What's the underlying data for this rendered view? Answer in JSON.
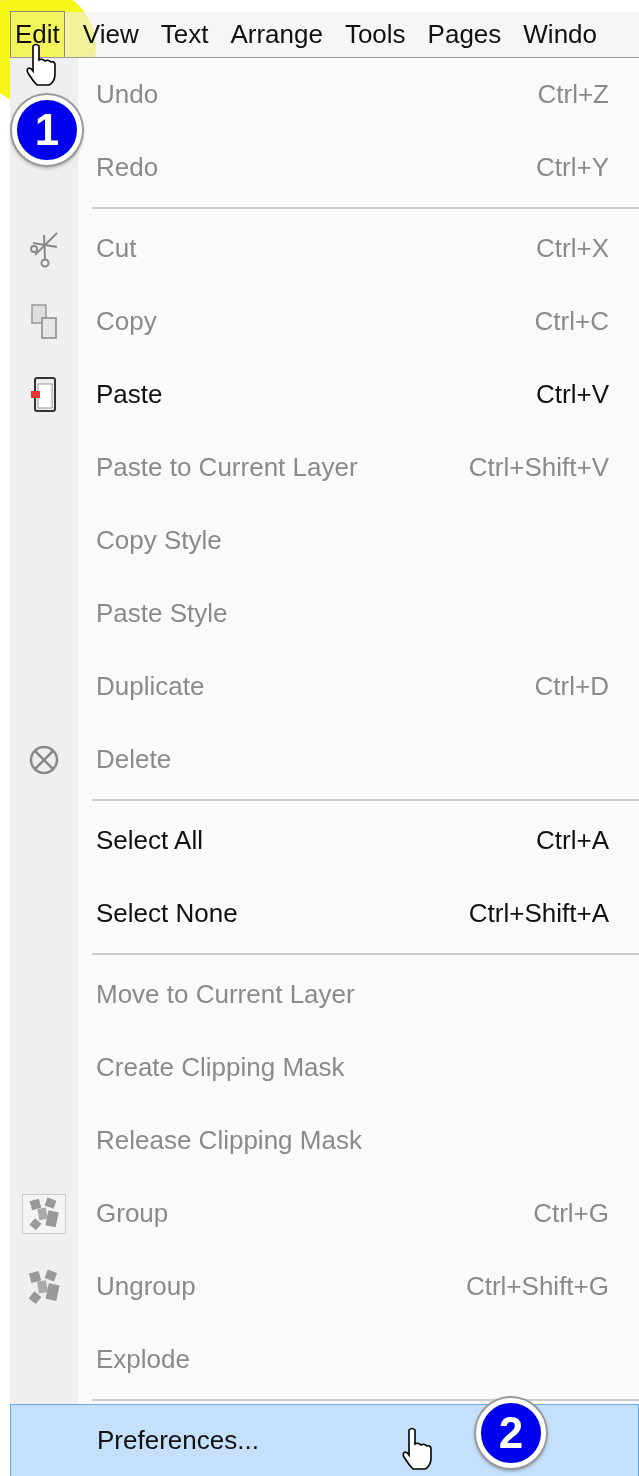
{
  "menu_bar": [
    {
      "label": "Edit",
      "selected": true
    },
    {
      "label": "View",
      "selected": false
    },
    {
      "label": "Text",
      "selected": false
    },
    {
      "label": "Arrange",
      "selected": false
    },
    {
      "label": "Tools",
      "selected": false
    },
    {
      "label": "Pages",
      "selected": false
    },
    {
      "label": "Windo",
      "selected": false
    }
  ],
  "menu": [
    {
      "kind": "item",
      "label": "Undo",
      "shortcut": "Ctrl+Z",
      "disabled": true,
      "selected": false
    },
    {
      "kind": "item",
      "label": "Redo",
      "shortcut": "Ctrl+Y",
      "disabled": true,
      "selected": false
    },
    {
      "kind": "separator"
    },
    {
      "kind": "scissors",
      "label": "Cut",
      "shortcut": "Ctrl+X",
      "disabled": true,
      "selected": false
    },
    {
      "kind": "copy",
      "label": "Copy",
      "shortcut": "Ctrl+C",
      "disabled": true,
      "selected": false
    },
    {
      "kind": "paste",
      "label": "Paste",
      "shortcut": "Ctrl+V",
      "disabled": false,
      "selected": false
    },
    {
      "kind": "item",
      "label": "Paste to Current Layer",
      "shortcut": "Ctrl+Shift+V",
      "disabled": true,
      "selected": false
    },
    {
      "kind": "item",
      "label": "Copy Style",
      "disabled": true,
      "selected": false
    },
    {
      "kind": "item",
      "label": "Paste Style",
      "disabled": true,
      "selected": false
    },
    {
      "kind": "item",
      "label": "Duplicate",
      "shortcut": "Ctrl+D",
      "disabled": true,
      "selected": false
    },
    {
      "kind": "delete",
      "label": "Delete",
      "disabled": true,
      "selected": false
    },
    {
      "kind": "separator"
    },
    {
      "kind": "item",
      "label": "Select All",
      "shortcut": "Ctrl+A",
      "disabled": false,
      "selected": false
    },
    {
      "kind": "item",
      "label": "Select None",
      "shortcut": "Ctrl+Shift+A",
      "disabled": false,
      "selected": false
    },
    {
      "kind": "separator"
    },
    {
      "kind": "item",
      "label": "Move to Current Layer",
      "disabled": true,
      "selected": false
    },
    {
      "kind": "item",
      "label": "Create Clipping Mask",
      "disabled": true,
      "selected": false
    },
    {
      "kind": "item",
      "label": "Release Clipping Mask",
      "disabled": true,
      "selected": false
    },
    {
      "kind": "group",
      "label": "Group",
      "shortcut": "Ctrl+G",
      "disabled": true,
      "selected": false
    },
    {
      "kind": "ungroup",
      "label": "Ungroup",
      "shortcut": "Ctrl+Shift+G",
      "disabled": true,
      "selected": false
    },
    {
      "kind": "item",
      "label": "Explode",
      "disabled": true,
      "selected": false
    },
    {
      "kind": "separator"
    },
    {
      "kind": "item",
      "label": "Preferences...",
      "disabled": false,
      "selected": true
    }
  ],
  "callouts": [
    "1",
    "2"
  ]
}
